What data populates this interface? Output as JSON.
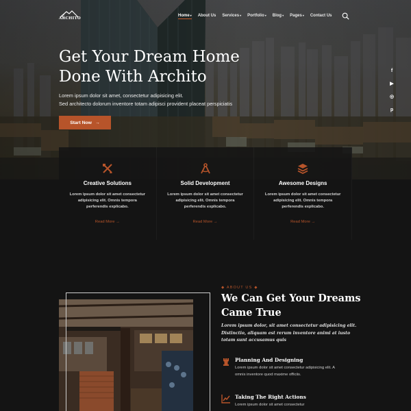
{
  "brand": {
    "name": "ARCHITO"
  },
  "nav": {
    "items": [
      {
        "label": "Home",
        "caret": true,
        "active": true
      },
      {
        "label": "About Us",
        "caret": false
      },
      {
        "label": "Services",
        "caret": true
      },
      {
        "label": "Portfolio",
        "caret": true
      },
      {
        "label": "Blog",
        "caret": true
      },
      {
        "label": "Pages",
        "caret": true
      },
      {
        "label": "Contact Us",
        "caret": false
      }
    ],
    "search_icon": "search-icon"
  },
  "hero": {
    "title_line1": "Get Your Dream Home",
    "title_line2": "Done With Archito",
    "desc_line1": "Lorem ipsum dolor sit amet, consectetur adipisicing elit.",
    "desc_line2": "Sed architecto dolorum inventore totam adipisci provident placeat perspiciatis",
    "button_label": "Start Now",
    "button_arrow": "→"
  },
  "social": [
    {
      "icon": "facebook-icon",
      "glyph": "f"
    },
    {
      "icon": "youtube-icon",
      "glyph": "▶"
    },
    {
      "icon": "instagram-icon",
      "glyph": "◎"
    },
    {
      "icon": "pinterest-icon",
      "glyph": "p"
    }
  ],
  "features": [
    {
      "icon": "pencil-ruler-icon",
      "title": "Creative Solutions",
      "text": "Lorem ipsum dolor sit amet consectetur adipisicing elit. Omnis tempora perferendis explicabo.",
      "link": "Read More →"
    },
    {
      "icon": "compass-icon",
      "title": "Solid Development",
      "text": "Lorem ipsum dolor sit amet consectetur adipisicing elit. Omnis tempora perferendis explicabo.",
      "link": "Read More →"
    },
    {
      "icon": "layers-icon",
      "title": "Awesome Designs",
      "text": "Lorem ipsum dolor sit amet consectetur adipisicing elit. Omnis tempora perferendis explicabo.",
      "link": "Read More →"
    }
  ],
  "about": {
    "tag": "ABOUT US",
    "title_line1": "We Can Get Your Dreams",
    "title_line2": "Came True",
    "intro": "Lorem ipsum dolor, sit amet consectetur adipisicing elit. Distinctio, aliquam est rerum inventore animi at iusto totam sunt accusamus quis",
    "items": [
      {
        "icon": "chess-rook-icon",
        "title": "Planning And Designing",
        "text": "Lorem ipsum dolor sit amet consectetur adipisicing elit. A omnis inventore quod maxime officiis."
      },
      {
        "icon": "chart-line-icon",
        "title": "Taking The Right Actions",
        "text": "Lorem ipsum dolor sit amet consectetur"
      }
    ]
  },
  "colors": {
    "accent": "#b7542a",
    "background": "#141414",
    "card": "#161616"
  }
}
